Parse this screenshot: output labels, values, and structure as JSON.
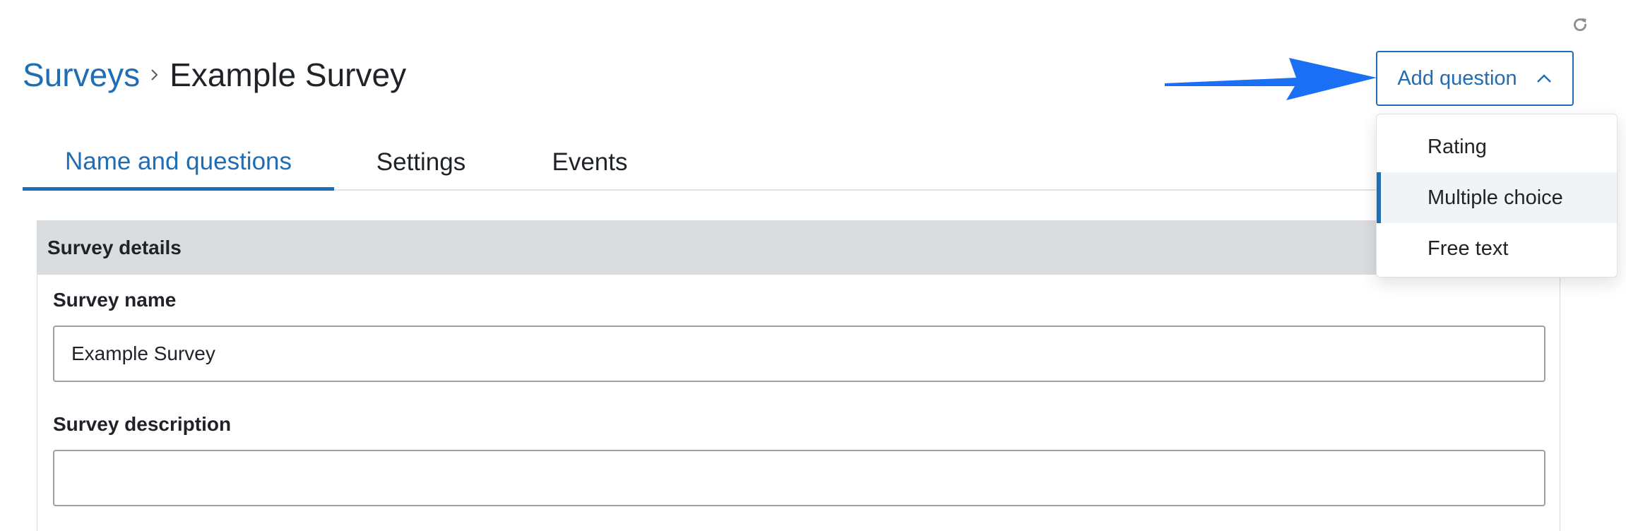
{
  "toolbar": {
    "refresh_icon": "refresh-icon"
  },
  "breadcrumb": {
    "parent": "Surveys",
    "separator_icon": "chevron-right-icon",
    "current": "Example Survey"
  },
  "annotation": {
    "arrow_color": "#1a6ff5"
  },
  "add_question": {
    "label": "Add question",
    "icon": "chevron-up-icon",
    "menu": [
      {
        "label": "Rating",
        "active": false
      },
      {
        "label": "Multiple choice",
        "active": true
      },
      {
        "label": "Free text",
        "active": false
      }
    ]
  },
  "tabs": [
    {
      "label": "Name and questions",
      "active": true
    },
    {
      "label": "Settings",
      "active": false
    },
    {
      "label": "Events",
      "active": false
    }
  ],
  "survey_details": {
    "header": "Survey details",
    "name_label": "Survey name",
    "name_value": "Example Survey",
    "description_label": "Survey description",
    "description_value": ""
  },
  "colors": {
    "accent": "#1e6db5",
    "panel_header_bg": "#dadde0",
    "menu_active_bg": "#f1f4f7"
  }
}
